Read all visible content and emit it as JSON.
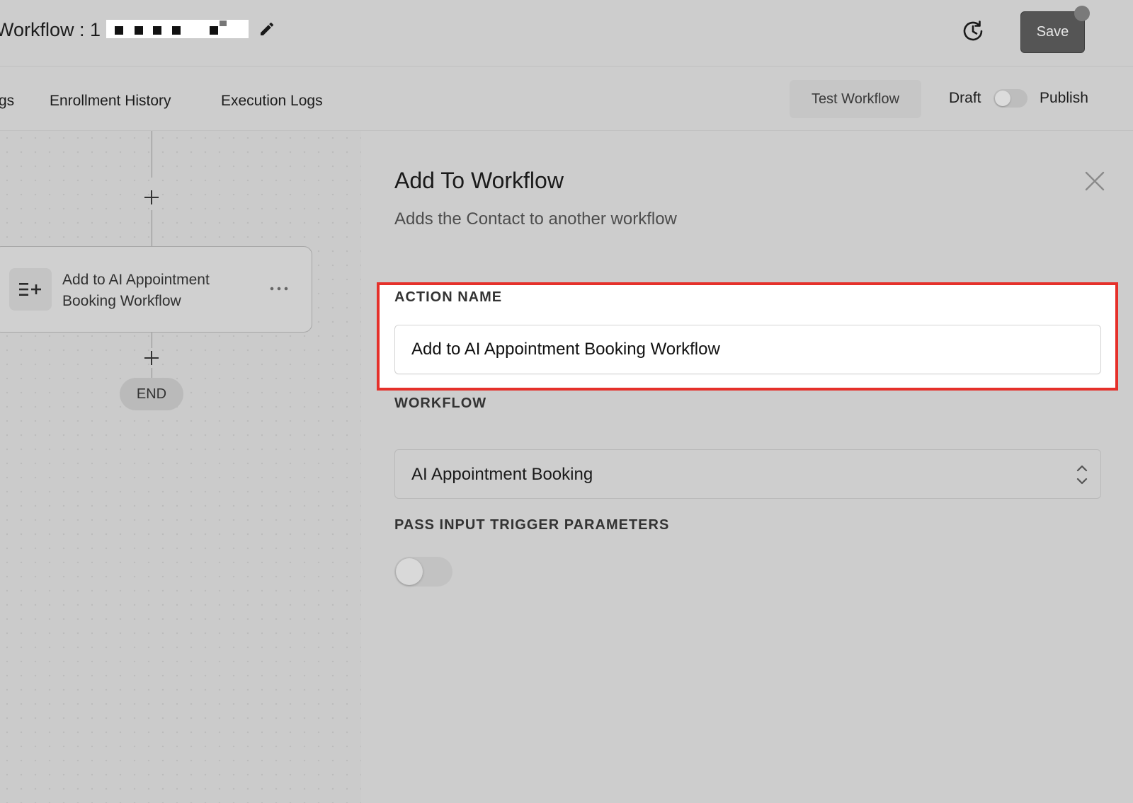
{
  "header": {
    "title_prefix": "Workflow : 1",
    "save_label": "Save",
    "icons": {
      "edit": "pencil-icon",
      "history": "history-clock-icon"
    }
  },
  "tabs": [
    {
      "label": "gs"
    },
    {
      "label": "Enrollment History"
    },
    {
      "label": "Execution Logs"
    }
  ],
  "toolbar": {
    "test_label": "Test Workflow",
    "draft_label": "Draft",
    "publish_label": "Publish",
    "publish_on": false
  },
  "canvas": {
    "node": {
      "label": "Add to AI Appointment Booking Workflow",
      "icon": "list-add-icon",
      "menu_icon": "more-horizontal-icon"
    },
    "end_label": "END"
  },
  "panel": {
    "title": "Add To Workflow",
    "subtitle": "Adds the Contact to another workflow",
    "action_name": {
      "label": "ACTION NAME",
      "value": "Add to AI Appointment Booking Workflow"
    },
    "workflow": {
      "label": "WORKFLOW",
      "value": "AI Appointment Booking"
    },
    "pass_params": {
      "label": "PASS INPUT TRIGGER PARAMETERS",
      "enabled": false
    }
  },
  "colors": {
    "highlight": "#e5302a",
    "save_button": "#555555",
    "background": "#cdcdcd"
  }
}
